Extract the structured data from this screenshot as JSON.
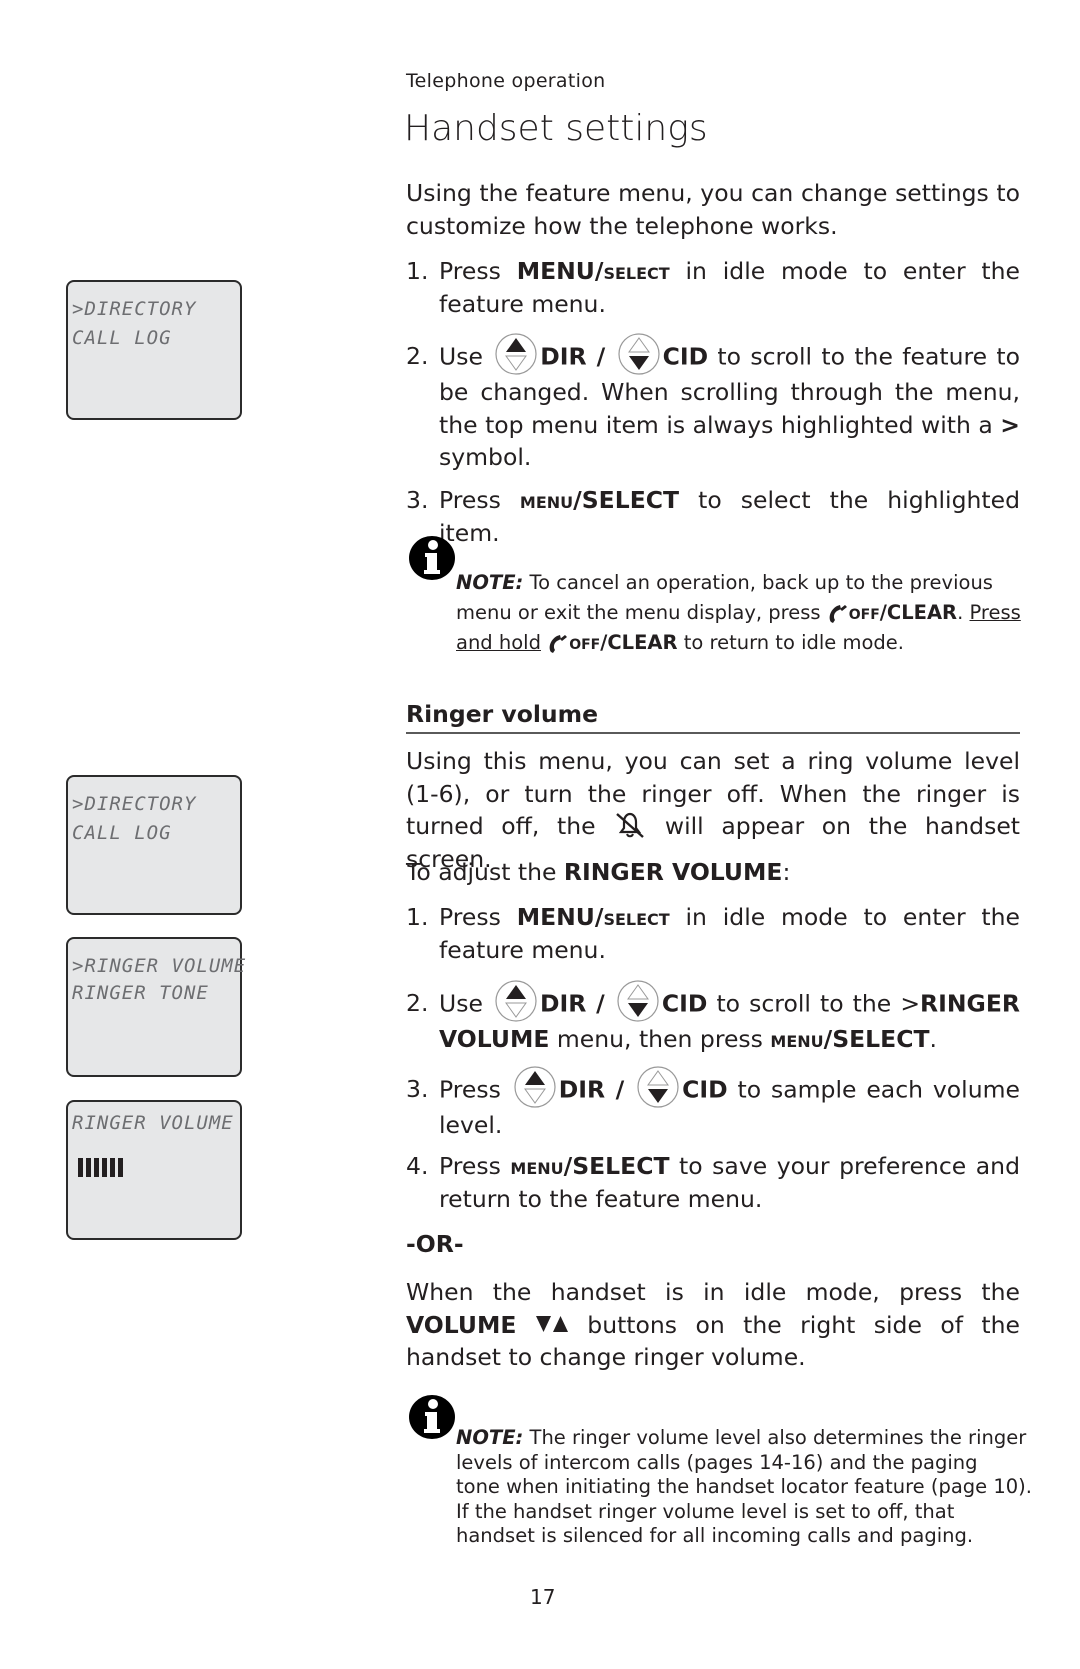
{
  "header": {
    "section": "Telephone operation",
    "title": "Handset settings"
  },
  "intro": "Using the feature menu, you can change settings to customize how the telephone works.",
  "general_steps": [
    {
      "num": "1.",
      "a": "Press ",
      "b": "MENU/",
      "c": "select",
      "d": " in idle mode to enter the feature menu."
    },
    {
      "num": "2.",
      "a": "Use ",
      "dir": "DIR /",
      "cid": "CID",
      "d": " to scroll to the feature to be changed. When scrolling through the menu, the top menu item is always highlighted with a ",
      "sym": ">",
      "e": " symbol."
    },
    {
      "num": "3.",
      "a": "Press ",
      "b": "menu",
      "c": "/SELECT",
      "d": " to select the highlighted item."
    }
  ],
  "note1": {
    "label": "NOTE:",
    "t1": " To cancel an operation, back up to the previous menu or exit the menu display, press ",
    "k1a": "off",
    "k1b": "/CLEAR",
    "t2": ". ",
    "u": "Press and hold",
    "t3": " ",
    "k2a": "off",
    "k2b": "/CLEAR",
    "t4": " to return to idle mode."
  },
  "ringer": {
    "heading": "Ringer volume",
    "body_a": "Using this menu, you can set a ring volume level (1-6), or turn the ringer off. When the ringer is turned off, the ",
    "body_b": " will appear on the handset screen.",
    "adjust_a": "To adjust the ",
    "adjust_b": "RINGER VOLUME",
    "adjust_c": ":",
    "steps": [
      {
        "num": "1.",
        "a": "Press ",
        "b": "MENU/",
        "c": "select",
        "d": " in idle mode to enter the feature menu."
      },
      {
        "num": "2.",
        "a": "Use ",
        "dir": "DIR /",
        "cid": "CID",
        "d": " to scroll to the >",
        "e": "RINGER VOLUME",
        "f": " menu, then press ",
        "g": "menu",
        "h": "/SELECT",
        "i": "."
      },
      {
        "num": "3.",
        "a": "Press ",
        "dir": "DIR /",
        "cid": "CID",
        "d": " to sample each volume level."
      },
      {
        "num": "4.",
        "a": "Press ",
        "b": "menu",
        "c": "/SELECT",
        "d": " to save your preference and return to the feature menu."
      }
    ],
    "or": "-OR-",
    "alt_a": "When the handset is in idle mode, press the ",
    "alt_b": "VOLUME",
    "alt_c": " buttons on the right side of the handset to change ringer volume."
  },
  "note2": {
    "label": "NOTE:",
    "lines": [
      " The ringer volume level also determines the ringer",
      "levels of intercom calls (pages 14-16) and the paging",
      "tone when initiating the handset locator feature (page 10).",
      "If the handset ringer volume level is set to off, that",
      "handset is silenced for all incoming calls and paging."
    ]
  },
  "screens": [
    {
      "lines": [
        ">DIRECTORY",
        " CALL LOG"
      ]
    },
    {
      "lines": [
        ">DIRECTORY",
        " CALL LOG"
      ]
    },
    {
      "lines": [
        ">RINGER VOLUME",
        " RINGER TONE"
      ]
    },
    {
      "lines": [
        "RINGER VOLUME"
      ],
      "volume_level": 6,
      "volume_max": 6
    }
  ],
  "page_number": "17"
}
